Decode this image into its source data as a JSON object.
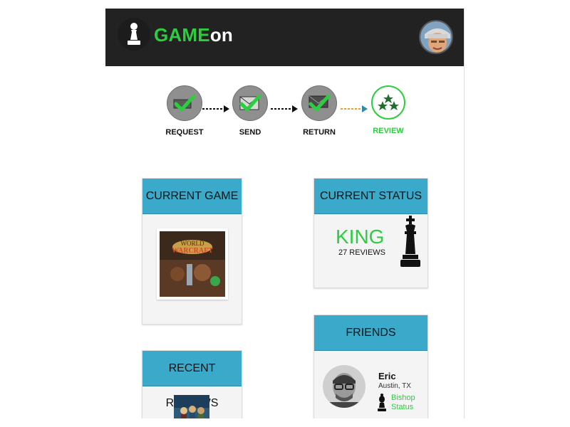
{
  "header": {
    "brand_prefix": "GAME",
    "brand_suffix": "on",
    "logo_icon": "pawn-icon",
    "profile_icon": "user-avatar"
  },
  "progress": {
    "steps": [
      {
        "label": "REQUEST",
        "state": "done",
        "icon": "request-check-icon"
      },
      {
        "label": "SEND",
        "state": "done",
        "icon": "send-check-icon"
      },
      {
        "label": "RETURN",
        "state": "done",
        "icon": "return-check-icon"
      },
      {
        "label": "REVIEW",
        "state": "active",
        "icon": "review-stars-icon"
      }
    ]
  },
  "cards": {
    "current_game": {
      "title": "CURRENT GAME",
      "image_icon": "world-of-warcraft-board-game-image"
    },
    "current_status": {
      "title": "CURRENT STATUS",
      "rank": "KING",
      "reviews": "27 REVIEWS",
      "icon": "king-piece-icon"
    },
    "friends": {
      "title": "FRIENDS",
      "friend": {
        "name": "Eric",
        "location": "Austin, TX",
        "status_line1": "Bishop",
        "status_line2": "Status",
        "icon": "bishop-piece-icon"
      }
    },
    "recent_reviews": {
      "title": "RECENT REVIEWS",
      "image_icon": "review-game-thumbnail"
    }
  },
  "colors": {
    "accent_green": "#2ecc40",
    "header_bg": "#222222",
    "card_header": "#3ba9c9",
    "card_bg": "#f4f4f4"
  }
}
